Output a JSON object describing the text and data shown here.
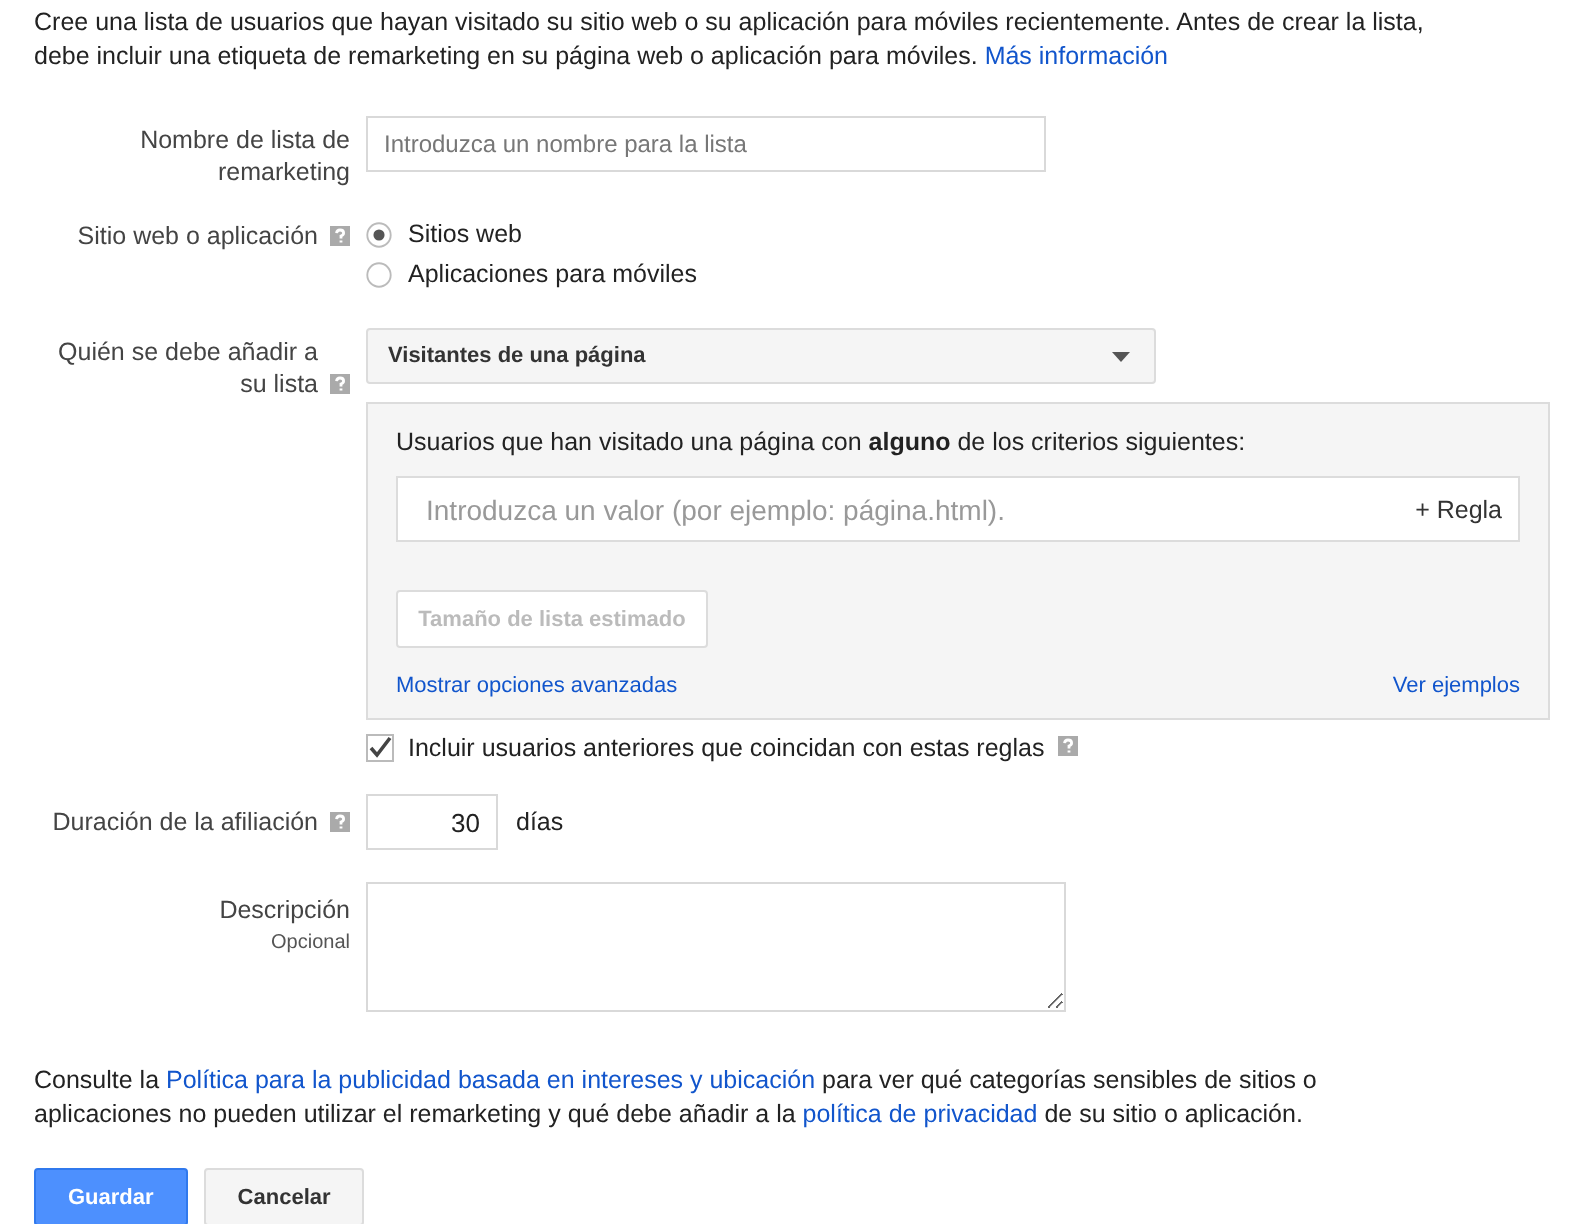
{
  "intro": {
    "text": "Cree una lista de usuarios que hayan visitado su sitio web o su aplicación para móviles recientemente. Antes de crear la lista, debe incluir una etiqueta de remarketing en su página web o aplicación para móviles.",
    "link": "Más información"
  },
  "list_name": {
    "label": "Nombre de lista de remarketing",
    "placeholder": "Introduzca un nombre para la lista"
  },
  "source": {
    "label": "Sitio web o aplicación",
    "help": true,
    "options": [
      {
        "label": "Sitios web",
        "selected": true
      },
      {
        "label": "Aplicaciones para móviles",
        "selected": false
      }
    ]
  },
  "who": {
    "label": "Quién se debe añadir a su lista",
    "help": true,
    "dropdown": "Visitantes de una página",
    "panel": {
      "criteria": "Usuarios que han visitado una página con **alguno** de los criterios siguientes:",
      "placeholder": "Introduzca un valor (por ejemplo: página.html).",
      "add_rule": "+ Regla",
      "estimate_button": {
        "label": "Tamaño de lista estimado",
        "disabled": true
      },
      "advanced_link": "Mostrar opciones avanzadas",
      "examples_link": "Ver ejemplos"
    },
    "include_past": {
      "label": "Incluir usuarios anteriores que coincidan con estas reglas",
      "checked": true,
      "help": true
    }
  },
  "duration": {
    "label": "Duración de la afiliación",
    "help": true,
    "value": "30",
    "unit": "días"
  },
  "description": {
    "label": "Descripción",
    "sublabel": "Opcional"
  },
  "policy": [
    {
      "kind": "text",
      "text": "Consulte la "
    },
    {
      "kind": "link",
      "text": "Política para la publicidad basada en intereses y ubicación"
    },
    {
      "kind": "text",
      "text": " para ver qué categorías sensibles de sitios o aplicaciones no pueden utilizar el remarketing y qué debe añadir a la "
    },
    {
      "kind": "link",
      "text": "política de privacidad"
    },
    {
      "kind": "text",
      "text": " de su sitio o aplicación."
    }
  ],
  "buttons": [
    {
      "label": "Guardar",
      "kind": "primary"
    },
    {
      "label": "Cancelar",
      "kind": "secondary"
    }
  ]
}
